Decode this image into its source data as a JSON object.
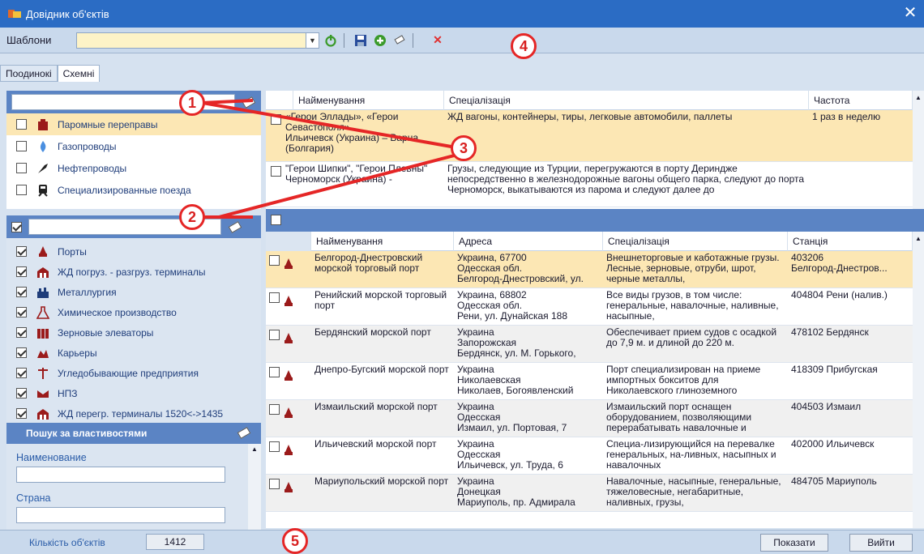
{
  "window": {
    "title": "Довідник об'єктів",
    "close": "✕"
  },
  "toolbar": {
    "label": "Шаблони",
    "template_value": ""
  },
  "tabs": [
    "Поодинокі",
    "Схемні"
  ],
  "top_list": [
    {
      "label": "Паромные переправы",
      "icon": "ferry-icon",
      "checked": false,
      "selected": true
    },
    {
      "label": "Газопроводы",
      "icon": "gas-flame-icon",
      "checked": false
    },
    {
      "label": "Нефтепроводы",
      "icon": "oil-pipeline-icon",
      "checked": false
    },
    {
      "label": "Специализированные поезда",
      "icon": "train-icon",
      "checked": false
    }
  ],
  "bottom_list": [
    {
      "label": "Порты",
      "icon": "port-icon"
    },
    {
      "label": "ЖД погруз. - разгруз. терминалы",
      "icon": "rail-terminal-icon"
    },
    {
      "label": "Металлургия",
      "icon": "metallurgy-icon"
    },
    {
      "label": "Химическое производство",
      "icon": "chemistry-icon"
    },
    {
      "label": "Зерновые элеваторы",
      "icon": "grain-elevator-icon"
    },
    {
      "label": "Карьеры",
      "icon": "quarry-icon"
    },
    {
      "label": "Угледобывающие предприятия",
      "icon": "coal-mine-icon"
    },
    {
      "label": "НПЗ",
      "icon": "refinery-icon"
    },
    {
      "label": "ЖД перегр. терминалы 1520<->1435",
      "icon": "rail-transfer-icon"
    }
  ],
  "properties": {
    "title": "Пошук за властивостями",
    "field1": "Наименование",
    "field2": "Страна"
  },
  "top_grid": {
    "headers": [
      "Найменування",
      "Спеціалізація",
      "Частота"
    ],
    "rows": [
      {
        "name": "«Герои Эллады», «Герои Севастополя»\nИльичевск (Украина) – Варна (Болгария)",
        "spec": "ЖД вагоны, контейнеры, тиры, легковые автомобили, паллеты",
        "freq": "1 раз в неделю"
      },
      {
        "name": "\"Герои Шипки\", \"Герои Плевны\"\nЧерноморск (Украина) -",
        "spec": "Грузы, следующие из Турции, перегружаются в порту Деринджe непосредственно в железнодорожные вагоны общего парка, следуют до порта Черноморск, выкатываются из парома и следуют далее до",
        "freq": ""
      }
    ]
  },
  "bottom_grid": {
    "headers": [
      "Найменування",
      "Адреса",
      "Спеціалізація",
      "Станція"
    ],
    "rows": [
      {
        "name": "Белгород-Днестровский морской торговый порт",
        "addr": "Украина, 67700\nОдесская обл.\nБелгород-Днестровский, ул.",
        "spec": "Внешнеторговые и каботажные грузы. Лесные, зерновые, отруби, шрот, черные металлы,",
        "station": "403206\nБелгород-Днестров..."
      },
      {
        "name": "Ренийский морской торговый порт",
        "addr": "Украина, 68802\nОдесская обл.\nРени, ул. Дунайская 188",
        "spec": "Все виды грузов, в том числе: генеральные, навалочные, наливные, насыпные,",
        "station": "404804 Рени (налив.)"
      },
      {
        "name": "Бердянский морской порт",
        "addr": "Украина\nЗапорожская\nБердянск, ул. М. Горького,",
        "spec": "Обеспечивает прием судов с осадкой до 7,9 м. и длиной до 220 м.",
        "station": "478102 Бердянск"
      },
      {
        "name": "Днепро-Бугский морской порт",
        "addr": "Украина\nНиколаевская\nНиколаев, Богоявленский",
        "spec": "Порт специализирован на приеме импортных бокситов для Николаевского глиноземного",
        "station": "418309 Прибугская"
      },
      {
        "name": "Измаильский морской порт",
        "addr": "Украина\nОдесская\nИзмаил, ул. Портовая, 7",
        "spec": "Измаильский порт оснащен оборудованием, позволяющими перерабатывать навалочные и",
        "station": "404503 Измаил"
      },
      {
        "name": "Ильичевский морской порт",
        "addr": "Украина\nОдесская\nИльичевск, ул. Труда, 6",
        "spec": "Специа-лизирующийся на перевалке генеральных, на-ливных, насыпных и навалочных",
        "station": "402000 Ильичевск"
      },
      {
        "name": "Мариупольский морской порт",
        "addr": "Украина\nДонецкая\nМариуполь, пр. Адмирала",
        "spec": "Навалочные, насыпные, генеральные, тяжеловесные, негабаритные, наливных, грузы,",
        "station": "484705 Мариуполь"
      }
    ]
  },
  "status": {
    "count_label": "Кількість об'єктів",
    "count_value": "1412",
    "show_label": "Показати",
    "exit_label": "Вийти"
  },
  "callouts": [
    "1",
    "2",
    "3",
    "4",
    "5"
  ],
  "colors": {
    "accent": "#2b6cc4",
    "selection": "#fce7b4",
    "callout": "#e52626"
  }
}
